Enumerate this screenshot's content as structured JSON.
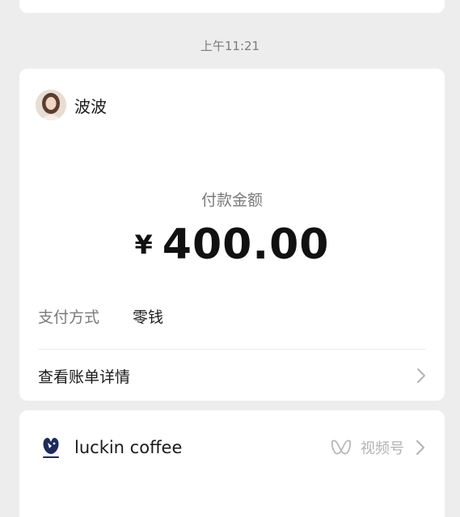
{
  "timestamp": "上午11:21",
  "payment": {
    "sender_name": "波波",
    "amount_label": "付款金额",
    "currency_symbol": "¥",
    "amount": "400.00",
    "method_label": "支付方式",
    "method_value": "零钱",
    "detail_link": "查看账单详情"
  },
  "merchant": {
    "brand_name": "luckin coffee",
    "logo_text": "luckin coffee",
    "channels_label": "视频号"
  },
  "colors": {
    "background": "#ededed",
    "card": "#ffffff",
    "muted_text": "#7a7a7a",
    "chevron": "#b3b3b3"
  }
}
